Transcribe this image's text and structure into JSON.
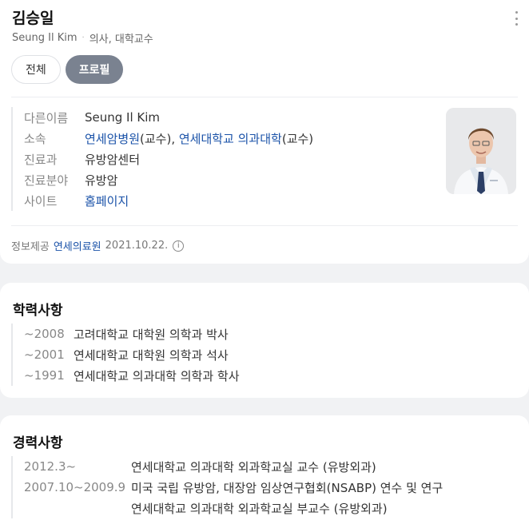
{
  "profile": {
    "name": "김승일",
    "english_name": "Seung Il Kim",
    "dot": "·",
    "occupation": "의사, 대학교수",
    "tabs": [
      {
        "label": "전체"
      },
      {
        "label": "프로필"
      }
    ],
    "info": {
      "other_name_label": "다른이름",
      "other_name_value": "Seung Il Kim",
      "affiliation_label": "소속",
      "affiliation_link1": "연세암병원",
      "affiliation_text1": "(교수), ",
      "affiliation_link2": "연세대학교 의과대학",
      "affiliation_text2": "(교수)",
      "department_label": "진료과",
      "department_value": "유방암센터",
      "specialty_label": "진료분야",
      "specialty_value": "유방암",
      "site_label": "사이트",
      "site_value": "홈페이지"
    },
    "source": {
      "label": "정보제공",
      "provider": "연세의료원",
      "date": "2021.10.22."
    }
  },
  "education": {
    "title": "학력사항",
    "items": [
      {
        "period": "~2008",
        "desc": "고려대학교 대학원 의학과 박사"
      },
      {
        "period": "~2001",
        "desc": "연세대학교 대학원 의학과 석사"
      },
      {
        "period": "~1991",
        "desc": "연세대학교 의과대학 의학과 학사"
      }
    ]
  },
  "career": {
    "title": "경력사항",
    "items": [
      {
        "period": "2012.3~",
        "desc": "연세대학교 의과대학 외과학교실 교수 (유방외과)"
      },
      {
        "period": "2007.10~2009.9",
        "desc": "미국 국립 유방암, 대장암 임상연구협회(NSABP) 연수 및 연구"
      },
      {
        "period": "",
        "desc": "연세대학교 의과대학 외과학교실 부교수 (유방외과)"
      }
    ]
  }
}
